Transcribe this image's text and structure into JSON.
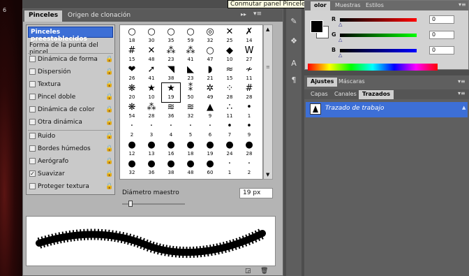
{
  "canvas": {
    "ruler_number": "6"
  },
  "brush_panel": {
    "tabs": [
      "Pinceles",
      "Origen de clonación"
    ],
    "presets_label": "Pinceles preestablecidos",
    "options": [
      {
        "label": "Forma de la punta del pincel",
        "checkbox": false,
        "lock": false
      },
      {
        "label": "Dinámica de forma",
        "checkbox": true,
        "checked": false,
        "lock": true
      },
      {
        "label": "Dispersión",
        "checkbox": true,
        "checked": false,
        "lock": true
      },
      {
        "label": "Textura",
        "checkbox": true,
        "checked": false,
        "lock": true
      },
      {
        "label": "Pincel doble",
        "checkbox": true,
        "checked": false,
        "lock": true
      },
      {
        "label": "Dinámica de color",
        "checkbox": true,
        "checked": false,
        "lock": true
      },
      {
        "label": "Otra dinámica",
        "checkbox": true,
        "checked": false,
        "lock": true
      },
      {
        "label": "Ruido",
        "checkbox": true,
        "checked": false,
        "lock": true
      },
      {
        "label": "Bordes húmedos",
        "checkbox": true,
        "checked": false,
        "lock": true
      },
      {
        "label": "Aerógrafo",
        "checkbox": true,
        "checked": false,
        "lock": true
      },
      {
        "label": "Suavizar",
        "checkbox": true,
        "checked": true,
        "lock": true
      },
      {
        "label": "Proteger textura",
        "checkbox": true,
        "checked": false,
        "lock": true
      }
    ],
    "brush_grid": {
      "rows": [
        [
          [
            "○",
            "18"
          ],
          [
            "○",
            "30"
          ],
          [
            "○",
            "35"
          ],
          [
            "○",
            "59"
          ],
          [
            "◎",
            "32"
          ],
          [
            "✕",
            "25"
          ],
          [
            "✗",
            "14"
          ]
        ],
        [
          [
            "#",
            "15"
          ],
          [
            "✕",
            "48"
          ],
          [
            "⁂",
            "23"
          ],
          [
            "⁂",
            "41"
          ],
          [
            "○",
            "47"
          ],
          [
            "◆",
            "10"
          ],
          [
            "W",
            "27"
          ]
        ],
        [
          [
            "❤",
            "26"
          ],
          [
            "➚",
            "41"
          ],
          [
            "◥",
            "38"
          ],
          [
            "◣",
            "23"
          ],
          [
            "◗",
            "21"
          ],
          [
            "≈",
            "15"
          ],
          [
            "≁",
            "11"
          ]
        ],
        [
          [
            "❋",
            "20"
          ],
          [
            "★",
            "10"
          ],
          [
            "★",
            "19"
          ],
          [
            "⁑",
            "50"
          ],
          [
            "✲",
            "49"
          ],
          [
            "⁘",
            "28"
          ],
          [
            "#",
            "28"
          ]
        ],
        [
          [
            "❋",
            "54"
          ],
          [
            "⁂",
            "28"
          ],
          [
            "≋",
            "36"
          ],
          [
            "≋",
            "32"
          ],
          [
            "▲",
            "9"
          ],
          [
            "∴",
            "11"
          ],
          [
            "•",
            "1"
          ]
        ],
        [
          [
            "·",
            "2"
          ],
          [
            "·",
            "3"
          ],
          [
            "·",
            "4"
          ],
          [
            "·",
            "5"
          ],
          [
            "·",
            "6"
          ],
          [
            "•",
            "7"
          ],
          [
            "•",
            "9"
          ]
        ],
        [
          [
            "●",
            "12"
          ],
          [
            "●",
            "13"
          ],
          [
            "●",
            "16"
          ],
          [
            "●",
            "18"
          ],
          [
            "●",
            "19"
          ],
          [
            "●",
            "24"
          ],
          [
            "●",
            "28"
          ]
        ],
        [
          [
            "●",
            "32"
          ],
          [
            "●",
            "36"
          ],
          [
            "●",
            "38"
          ],
          [
            "●",
            "48"
          ],
          [
            "●",
            "60"
          ],
          [
            "·",
            "1"
          ],
          [
            "·",
            "2"
          ]
        ]
      ],
      "selected": [
        3,
        2
      ]
    },
    "diameter_label": "Diámetro maestro",
    "diameter_value": "19 px",
    "diameter_slider_fraction": 0.13
  },
  "tooltip": "Conmutar panel Pinceles",
  "color_panel": {
    "tabs": [
      "olor",
      "Muestras",
      "Estilos"
    ],
    "active_tab": "olor",
    "sliders": [
      {
        "label": "R",
        "value": "0",
        "color_start": "#000000",
        "color_end": "#ff0000"
      },
      {
        "label": "G",
        "value": "0",
        "color_start": "#000000",
        "color_end": "#00ff00"
      },
      {
        "label": "B",
        "value": "0",
        "color_start": "#000000",
        "color_end": "#0000ff"
      }
    ]
  },
  "adjust_panel": {
    "tabs": [
      "Ajustes",
      "Máscaras"
    ]
  },
  "paths_panel": {
    "tabs": [
      "Capas",
      "Canales",
      "Trazados"
    ],
    "active_tab": "Trazados",
    "items": [
      {
        "label": "Trazado de trabajo"
      }
    ]
  }
}
